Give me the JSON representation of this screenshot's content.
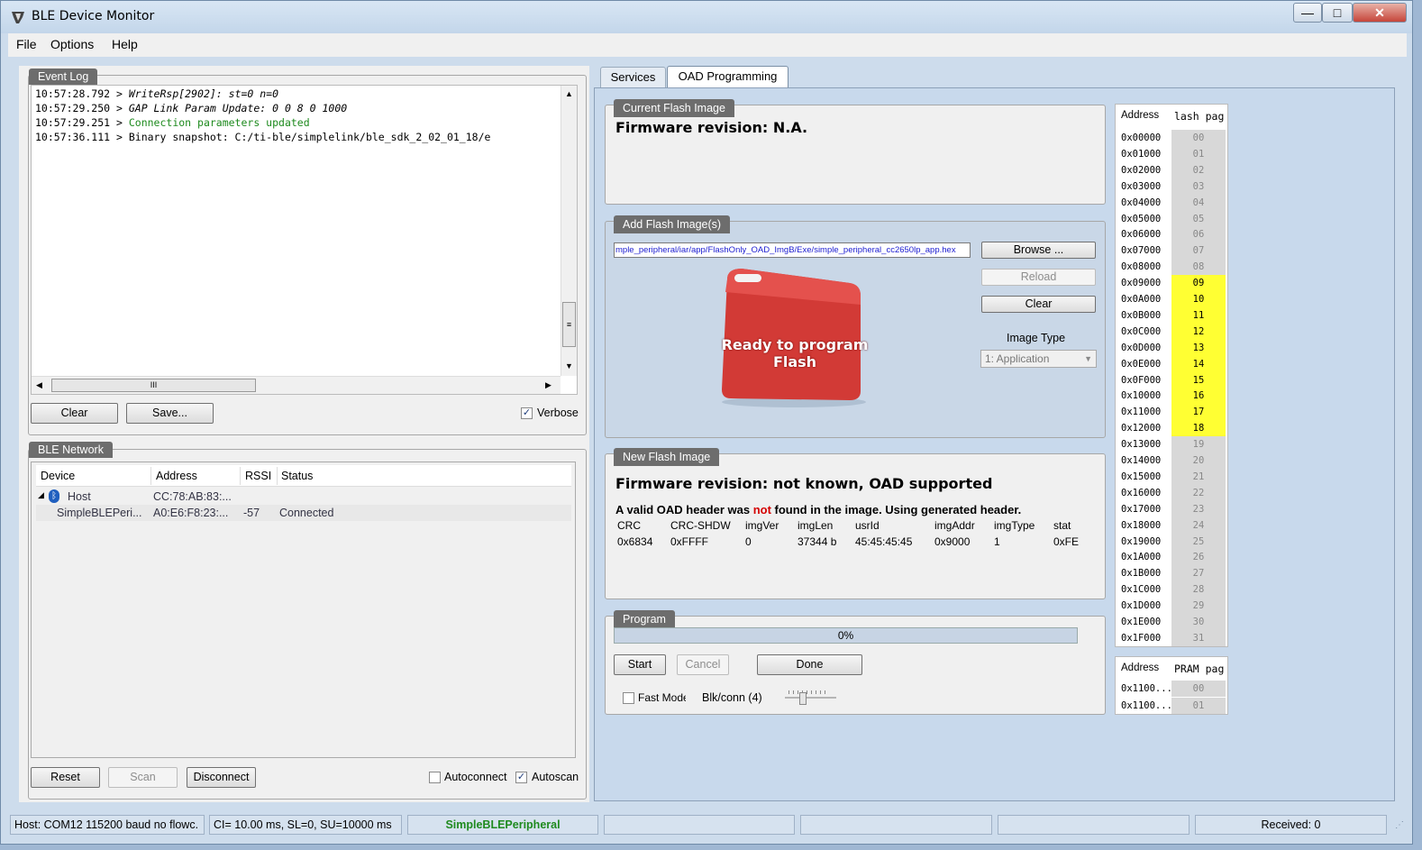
{
  "window": {
    "title": "BLE Device Monitor",
    "minimize": "—",
    "maximize": "□",
    "close": "✕"
  },
  "menu": {
    "file": "File",
    "options": "Options",
    "help": "Help"
  },
  "event_log": {
    "title": "Event Log",
    "lines": [
      {
        "time": "10:57:28.792 > ",
        "text": "WriteRsp[2902]: st=0 n=0"
      },
      {
        "time": "10:57:29.250 > ",
        "text": "GAP Link Param Update: 0 0 8 0 1000"
      },
      {
        "time": "10:57:29.251 > ",
        "text": "Connection parameters updated"
      },
      {
        "time": "10:57:36.111 > ",
        "text": "Binary snapshot: C:/ti-ble/simplelink/ble_sdk_2_02_01_18/e"
      }
    ],
    "clear": "Clear",
    "save": "Save...",
    "verbose": "Verbose",
    "hscroll_grip": "III",
    "vscroll_grip": "≡"
  },
  "ble_network": {
    "title": "BLE Network",
    "columns": [
      "Device",
      "Address",
      "RSSI",
      "Status"
    ],
    "host": {
      "name": "Host",
      "address": "CC:78:AB:83:..."
    },
    "device": {
      "name": "SimpleBLEPeri...",
      "address": "A0:E6:F8:23:...",
      "rssi": "-57",
      "status": "Connected"
    },
    "reset": "Reset",
    "scan": "Scan",
    "disconnect": "Disconnect",
    "autoconnect": "Autoconnect",
    "autoscan": "Autoscan"
  },
  "tabs": {
    "services": "Services",
    "oad": "OAD Programming"
  },
  "current_flash": {
    "title": "Current Flash Image",
    "revision": "Firmware revision: N.A."
  },
  "add_flash": {
    "title": "Add Flash Image(s)",
    "path": "mple_peripheral/iar/app/FlashOnly_OAD_ImgB/Exe/simple_peripheral_cc2650lp_app.hex",
    "browse": "Browse ...",
    "reload": "Reload",
    "clear": "Clear",
    "image_type_label": "Image Type",
    "image_type_value": "1: Application",
    "overlay": "Ready to program Flash"
  },
  "new_flash": {
    "title": "New Flash Image",
    "revision": "Firmware revision: not known, OAD supported",
    "warn_pre": "A valid OAD header was ",
    "warn_not": "not",
    "warn_post": " found in the image. Using generated header.",
    "headers": [
      "CRC",
      "CRC-SHDW",
      "imgVer",
      "imgLen",
      "usrId",
      "imgAddr",
      "imgType",
      "stat"
    ],
    "values": [
      "0x6834",
      "0xFFFF",
      "0",
      "37344 b",
      "45:45:45:45",
      "0x9000",
      "1",
      "0xFE"
    ]
  },
  "program": {
    "title": "Program",
    "progress": "0%",
    "progress_value": 0,
    "start": "Start",
    "cancel": "Cancel",
    "done": "Done",
    "fast_mode": "Fast Mode",
    "blk_conn": "Blk/conn (4)"
  },
  "flash_map": {
    "col_address": "Address",
    "col_page": "lash pag",
    "rows": [
      {
        "addr": "0x00000",
        "page": "00",
        "used": false
      },
      {
        "addr": "0x01000",
        "page": "01",
        "used": false
      },
      {
        "addr": "0x02000",
        "page": "02",
        "used": false
      },
      {
        "addr": "0x03000",
        "page": "03",
        "used": false
      },
      {
        "addr": "0x04000",
        "page": "04",
        "used": false
      },
      {
        "addr": "0x05000",
        "page": "05",
        "used": false
      },
      {
        "addr": "0x06000",
        "page": "06",
        "used": false
      },
      {
        "addr": "0x07000",
        "page": "07",
        "used": false
      },
      {
        "addr": "0x08000",
        "page": "08",
        "used": false
      },
      {
        "addr": "0x09000",
        "page": "09",
        "used": true
      },
      {
        "addr": "0x0A000",
        "page": "10",
        "used": true
      },
      {
        "addr": "0x0B000",
        "page": "11",
        "used": true
      },
      {
        "addr": "0x0C000",
        "page": "12",
        "used": true
      },
      {
        "addr": "0x0D000",
        "page": "13",
        "used": true
      },
      {
        "addr": "0x0E000",
        "page": "14",
        "used": true
      },
      {
        "addr": "0x0F000",
        "page": "15",
        "used": true
      },
      {
        "addr": "0x10000",
        "page": "16",
        "used": true
      },
      {
        "addr": "0x11000",
        "page": "17",
        "used": true
      },
      {
        "addr": "0x12000",
        "page": "18",
        "used": true
      },
      {
        "addr": "0x13000",
        "page": "19",
        "used": false
      },
      {
        "addr": "0x14000",
        "page": "20",
        "used": false
      },
      {
        "addr": "0x15000",
        "page": "21",
        "used": false
      },
      {
        "addr": "0x16000",
        "page": "22",
        "used": false
      },
      {
        "addr": "0x17000",
        "page": "23",
        "used": false
      },
      {
        "addr": "0x18000",
        "page": "24",
        "used": false
      },
      {
        "addr": "0x19000",
        "page": "25",
        "used": false
      },
      {
        "addr": "0x1A000",
        "page": "26",
        "used": false
      },
      {
        "addr": "0x1B000",
        "page": "27",
        "used": false
      },
      {
        "addr": "0x1C000",
        "page": "28",
        "used": false
      },
      {
        "addr": "0x1D000",
        "page": "29",
        "used": false
      },
      {
        "addr": "0x1E000",
        "page": "30",
        "used": false
      },
      {
        "addr": "0x1F000",
        "page": "31",
        "used": false
      }
    ]
  },
  "pram_map": {
    "col_address": "Address",
    "col_page": "PRAM pag",
    "rows": [
      {
        "addr": "0x1100...",
        "page": "00"
      },
      {
        "addr": "0x1100...",
        "page": "01"
      }
    ]
  },
  "status_bar": {
    "host": "Host: COM12 115200 baud no flowc.",
    "conn": "CI= 10.00 ms, SL=0, SU=10000 ms",
    "device": "SimpleBLEPeripheral",
    "received": "Received: 0"
  },
  "colors": {
    "used_page": "#ffff33",
    "device_green": "#1e8a1e",
    "not_red": "#d40000"
  }
}
